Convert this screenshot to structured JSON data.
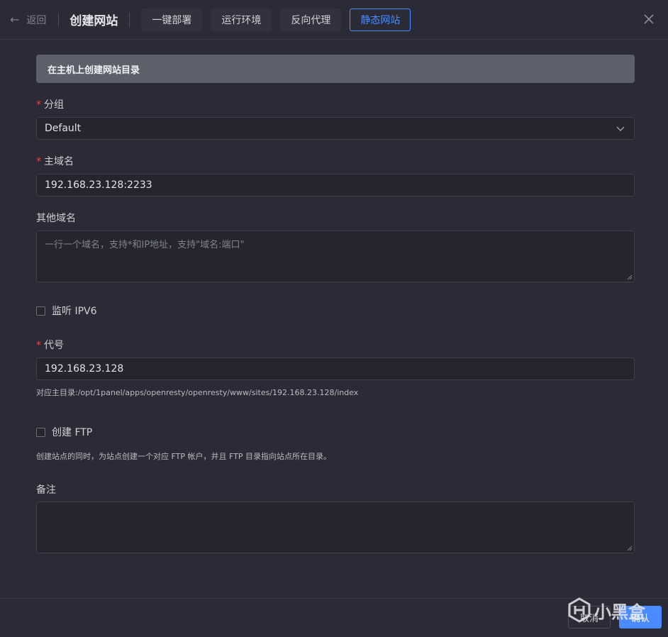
{
  "header": {
    "back_label": "返回",
    "title": "创建网站",
    "tabs": [
      {
        "label": "一键部署",
        "active": false
      },
      {
        "label": "运行环境",
        "active": false
      },
      {
        "label": "反向代理",
        "active": false
      },
      {
        "label": "静态网站",
        "active": true
      }
    ]
  },
  "form": {
    "banner": "在主机上创建网站目录",
    "group": {
      "label": "分组",
      "value": "Default"
    },
    "primary_domain": {
      "label": "主域名",
      "value": "192.168.23.128:2233"
    },
    "other_domains": {
      "label": "其他域名",
      "placeholder": "一行一个域名，支持*和IP地址，支持\"域名:端口\""
    },
    "ipv6": {
      "label": "监听 IPV6",
      "checked": false
    },
    "alias": {
      "label": "代号",
      "value": "192.168.23.128",
      "hint": "对应主目录:/opt/1panel/apps/openresty/openresty/www/sites/192.168.23.128/index"
    },
    "ftp": {
      "label": "创建 FTP",
      "checked": false,
      "hint": "创建站点的同时，为站点创建一个对应 FTP 帐户，并且 FTP 目录指向站点所在目录。"
    },
    "remark": {
      "label": "备注",
      "value": ""
    }
  },
  "footer": {
    "cancel_label": "取消",
    "confirm_label": "确认"
  },
  "watermark": {
    "text": "小黑盒"
  },
  "colors": {
    "accent": "#4a8cff",
    "required": "#e04b4b",
    "background": "#2a2b36"
  }
}
